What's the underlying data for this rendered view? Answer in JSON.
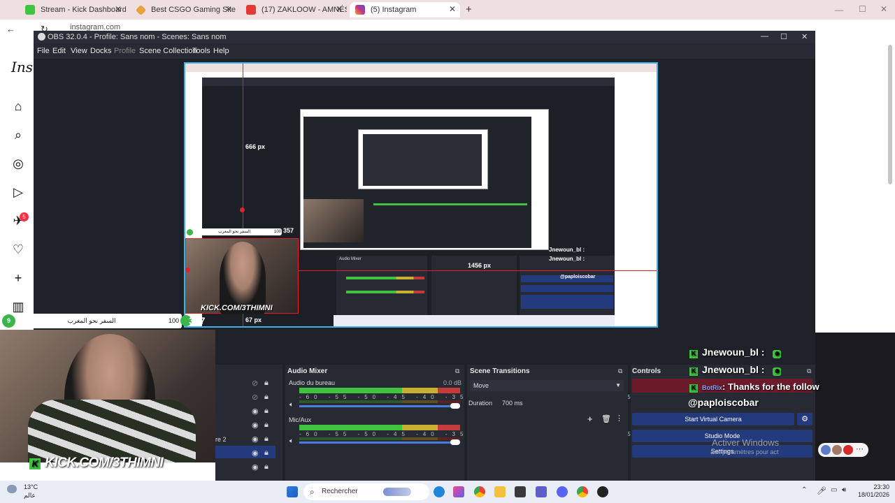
{
  "browser": {
    "tabs": [
      {
        "label": "Stream - Kick Dashboard",
        "color": "#3ec43e"
      },
      {
        "label": "Best CSGO Gaming Site: Play Ba",
        "color": "#e6a23c"
      },
      {
        "label": "(17) ZAKLOOW - AMNÉSIE ft. G",
        "color": "#e53935"
      },
      {
        "label": "(5) Instagram",
        "color": "#c13584"
      }
    ],
    "url": "instagram.com"
  },
  "instagram": {
    "logo_text": "Inst",
    "notification_count": "5"
  },
  "obs": {
    "title": "OBS 32.0.4 - Profile: Sans nom - Scenes: Sans nom",
    "menu": [
      "File",
      "Edit",
      "View",
      "Docks",
      "Profile",
      "Scene Collection",
      "Tools",
      "Help"
    ],
    "measure_666": "666 px",
    "measure_1456": "1456 px",
    "measure_67": "67 px",
    "measure_67_inner": "67 px",
    "measure_1456_inner": "1456 px",
    "measure_666_inner": "666 px"
  },
  "overlay": {
    "level": "9",
    "rank_text": "السفر نحو المغرب",
    "points": "100",
    "followers": "357",
    "inner_points": "100",
    "inner_followers": "357",
    "kick_handle": "KICK.COM/3THIMNI",
    "inner_kick_handle": "KICK.COM/3THIMNI"
  },
  "audio_mixer": {
    "title": "Audio Mixer",
    "channels": [
      {
        "name": "Audio du bureau",
        "db": "0.0 dB"
      },
      {
        "name": "Mic/Aux",
        "db": "0.0 dB"
      }
    ],
    "scale": "-60 -55 -50 -45 -40 -35 -30 -25 -20 -15 -10 -5 0"
  },
  "scene_transitions": {
    "title": "Scene Transitions",
    "selected": "Move",
    "duration_label": "Duration",
    "duration_value": "700 ms"
  },
  "controls": {
    "title": "Controls",
    "start_virtual_camera": "Start Virtual Camera",
    "studio_mode": "Studio Mode",
    "settings": "Settings"
  },
  "sources": {
    "partial_label": "re 2"
  },
  "chat": {
    "lines": [
      {
        "user": "Jnewoun_bl :",
        "msg": ""
      },
      {
        "user": "Jnewoun_bl :",
        "msg": ""
      },
      {
        "user": "BotRix",
        "msg": ": Thanks for the follow"
      }
    ],
    "highlight": "@paploiscobar"
  },
  "watermark": {
    "title": "Activer Windows",
    "subtitle": "aux paramètres pour act"
  },
  "taskbar": {
    "temperature": "13°C",
    "weather_text": "عالم",
    "search_placeholder": "Rechercher",
    "time": "23:30",
    "date": "18/01/2026"
  }
}
